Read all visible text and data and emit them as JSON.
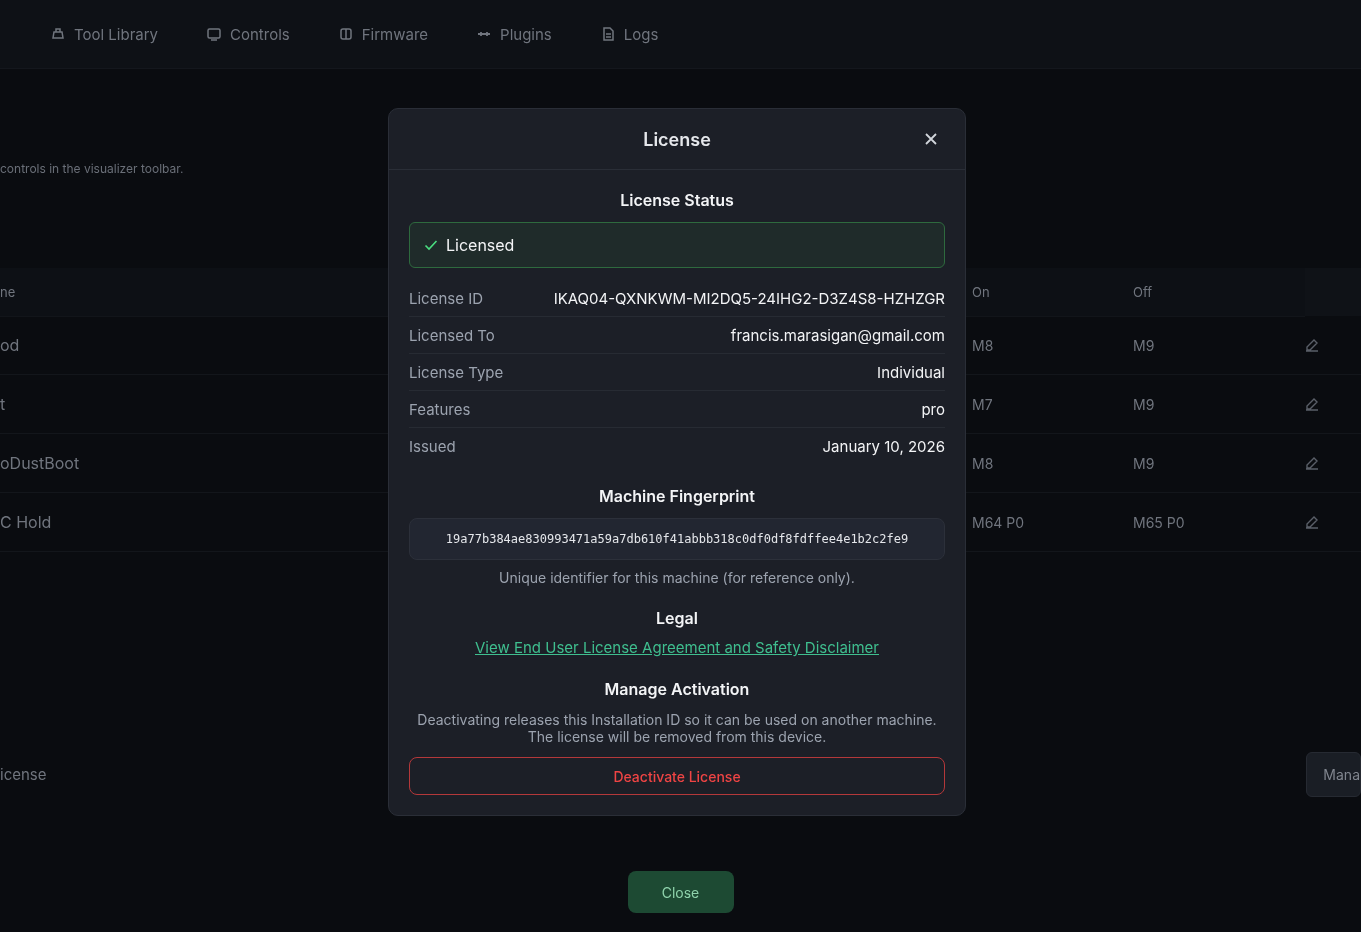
{
  "background": {
    "tabs": [
      {
        "label": "Tool Library"
      },
      {
        "label": "Controls"
      },
      {
        "label": "Firmware"
      },
      {
        "label": "Plugins"
      },
      {
        "label": "Logs"
      }
    ],
    "subtitle": "controls in the visualizer toolbar.",
    "table": {
      "columns": [
        "ne",
        "On",
        "Off"
      ],
      "rows": [
        {
          "column_1": "od",
          "on": "M8",
          "off": "M9"
        },
        {
          "column_1": "t",
          "on": "M7",
          "off": "M9"
        },
        {
          "column_1": "oDustBoot",
          "on": "M8",
          "off": "M9"
        },
        {
          "column_1": "C Hold",
          "on": "M64  P0",
          "off": "M65  P0"
        }
      ]
    },
    "license_label": "icense",
    "manage_button": "Mana",
    "close_button": "Close"
  },
  "dialog": {
    "title": "License",
    "status_heading": "License Status",
    "status": {
      "label": "Licensed",
      "kind": "success"
    },
    "details": [
      {
        "label": "License ID",
        "value": "IKAQ04-QXNKWM-MI2DQ5-24IHG2-D3Z4S8-HZHZGR"
      },
      {
        "label": "Licensed To",
        "value": "francis.marasigan@gmail.com"
      },
      {
        "label": "License Type",
        "value": "Individual"
      },
      {
        "label": "Features",
        "value": "pro"
      },
      {
        "label": "Issued",
        "value": "January 10, 2026"
      }
    ],
    "fingerprint_heading": "Machine Fingerprint",
    "fingerprint": "19a77b384ae830993471a59a7db610f41abbb318c0df0df8fdffee4e1b2c2fe9",
    "fingerprint_note": "Unique identifier for this machine (for reference only).",
    "legal_heading": "Legal",
    "legal_link": "View End User License Agreement and Safety Disclaimer",
    "manage_heading": "Manage Activation",
    "manage_note": [
      "Deactivating releases this Installation ID so it can be used on another machine.",
      "The license will be removed from this device."
    ],
    "deactivate_button": "Deactivate License"
  }
}
